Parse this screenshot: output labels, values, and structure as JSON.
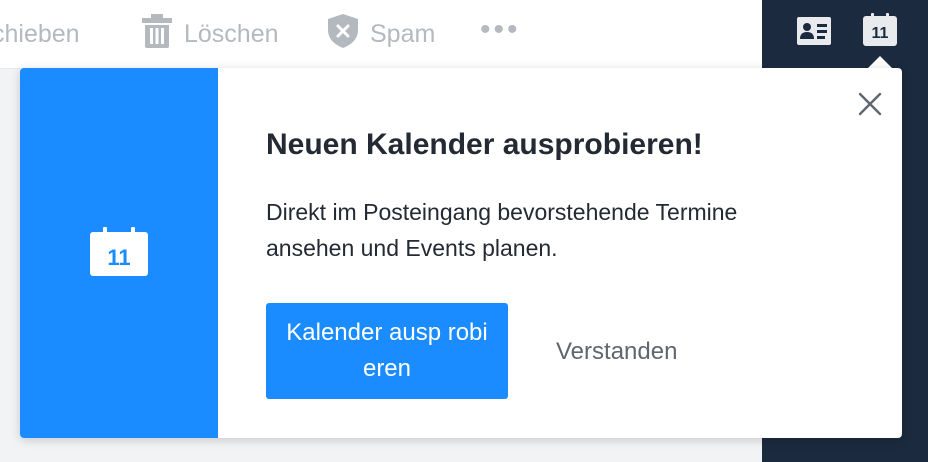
{
  "toolbar": {
    "move_label": "chieben",
    "delete_label": "Löschen",
    "spam_label": "Spam",
    "more_label": "•••"
  },
  "header_icons": {
    "contacts_icon": "contacts-card-icon",
    "calendar_icon": "calendar-icon",
    "calendar_day": "11"
  },
  "popover": {
    "calendar_day": "11",
    "title": "Neuen Kalender ausprobieren!",
    "body": "Direkt im Posteingang bevorstehende Termine ansehen und Events planen.",
    "primary_label": "Kalender ausp robieren",
    "secondary_label": "Verstanden",
    "close_icon": "close-icon"
  },
  "colors": {
    "accent": "#1a8cff",
    "dark_panel": "#1b2a3e",
    "text": "#232a33",
    "muted_toolbar": "#b4b9c0"
  }
}
